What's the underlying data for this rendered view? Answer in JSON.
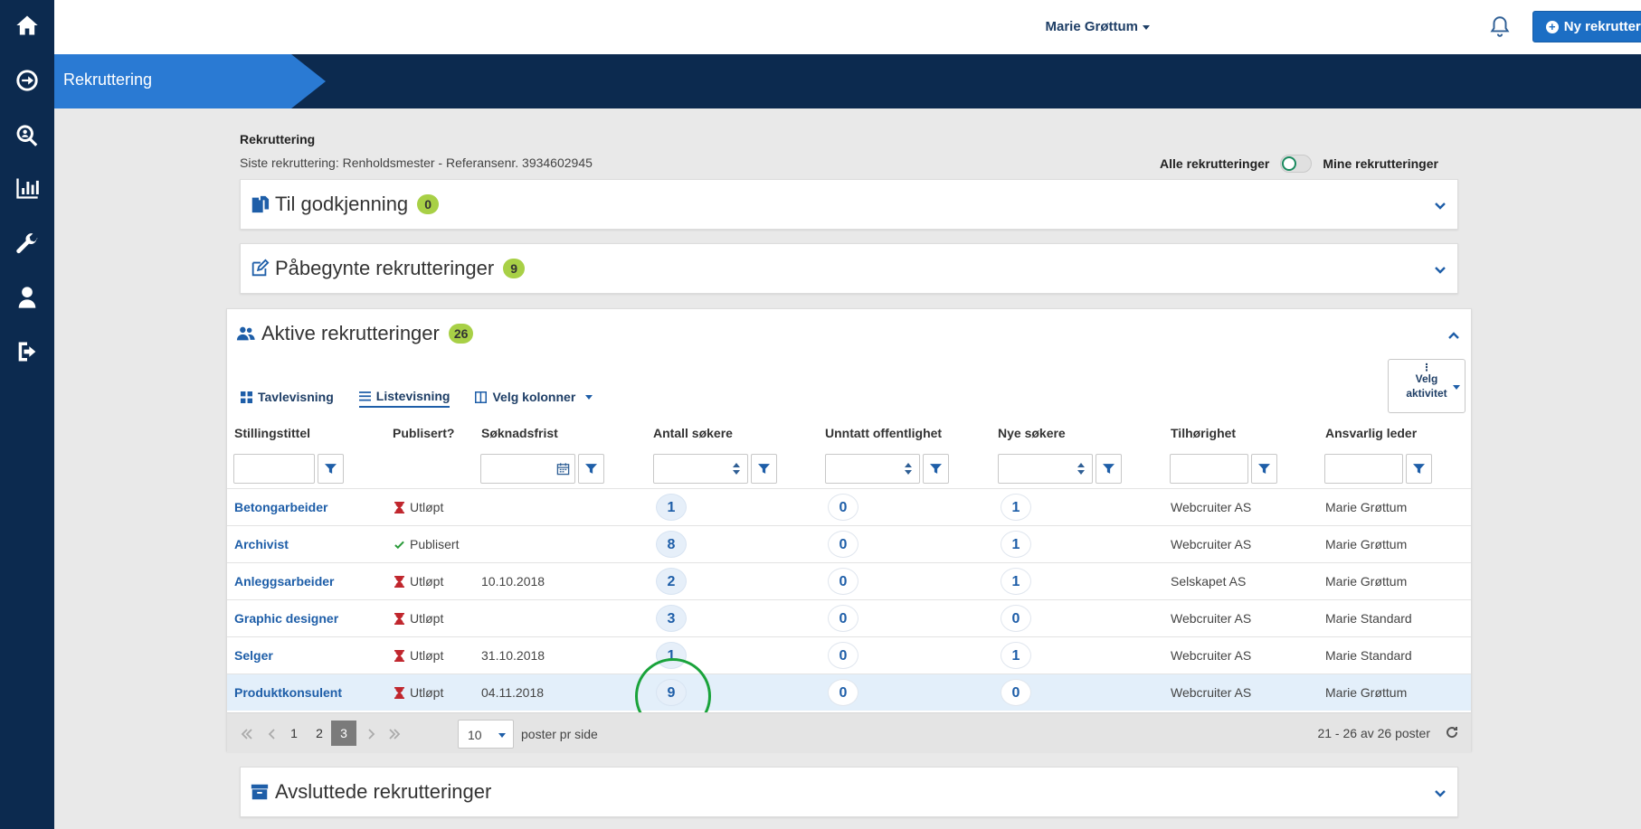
{
  "header": {
    "user_name": "Marie Grøttum",
    "new_button": "Ny rekruttering"
  },
  "breadcrumb": {
    "label": "Rekruttering"
  },
  "page": {
    "title": "Rekruttering",
    "last_recruitment": "Siste rekruttering: Renholdsmester - Referansenr. 3934602945",
    "scope_all": "Alle rekrutteringer",
    "scope_mine": "Mine rekrutteringer"
  },
  "panels": {
    "approval": {
      "title": "Til godkjenning",
      "count": "0"
    },
    "started": {
      "title": "Påbegynte rekrutteringer",
      "count": "9"
    },
    "active": {
      "title": "Aktive rekrutteringer",
      "count": "26"
    },
    "closed": {
      "title": "Avsluttede rekrutteringer"
    }
  },
  "views": {
    "board": "Tavlevisning",
    "list": "Listevisning",
    "columns": "Velg kolonner"
  },
  "activity_button": {
    "line1": "Velg",
    "line2": "aktivitet"
  },
  "columns": {
    "title": "Stillingstittel",
    "published": "Publisert?",
    "deadline": "Søknadsfrist",
    "applicants": "Antall søkere",
    "exempt": "Unntatt offentlighet",
    "new": "Nye søkere",
    "company": "Tilhørighet",
    "manager": "Ansvarlig leder"
  },
  "rows": [
    {
      "title": "Betongarbeider",
      "status": "Utløpt",
      "status_type": "expired",
      "deadline": "",
      "applicants": "1",
      "exempt": "0",
      "new": "1",
      "company": "Webcruiter AS",
      "manager": "Marie Grøttum"
    },
    {
      "title": "Archivist",
      "status": "Publisert",
      "status_type": "published",
      "deadline": "",
      "applicants": "8",
      "exempt": "0",
      "new": "1",
      "company": "Webcruiter AS",
      "manager": "Marie Grøttum"
    },
    {
      "title": "Anleggsarbeider",
      "status": "Utløpt",
      "status_type": "expired",
      "deadline": "10.10.2018",
      "applicants": "2",
      "exempt": "0",
      "new": "1",
      "company": "Selskapet AS",
      "manager": "Marie Grøttum"
    },
    {
      "title": "Graphic designer",
      "status": "Utløpt",
      "status_type": "expired",
      "deadline": "",
      "applicants": "3",
      "exempt": "0",
      "new": "0",
      "company": "Webcruiter AS",
      "manager": "Marie Standard"
    },
    {
      "title": "Selger",
      "status": "Utløpt",
      "status_type": "expired",
      "deadline": "31.10.2018",
      "applicants": "1",
      "exempt": "0",
      "new": "1",
      "company": "Webcruiter AS",
      "manager": "Marie Standard"
    },
    {
      "title": "Produktkonsulent",
      "status": "Utløpt",
      "status_type": "expired",
      "deadline": "04.11.2018",
      "applicants": "9",
      "exempt": "0",
      "new": "0",
      "company": "Webcruiter AS",
      "manager": "Marie Grøttum"
    }
  ],
  "pager": {
    "pages": [
      "1",
      "2",
      "3"
    ],
    "current": "3",
    "page_size": "10",
    "per_page_label": "poster pr side",
    "range": "21 - 26 av 26 poster"
  },
  "colors": {
    "sidebar": "#0c2a4f",
    "accent": "#1c6ec4",
    "badge": "#a8d046",
    "link": "#1e5ea8",
    "highlight": "#1aa33b"
  }
}
